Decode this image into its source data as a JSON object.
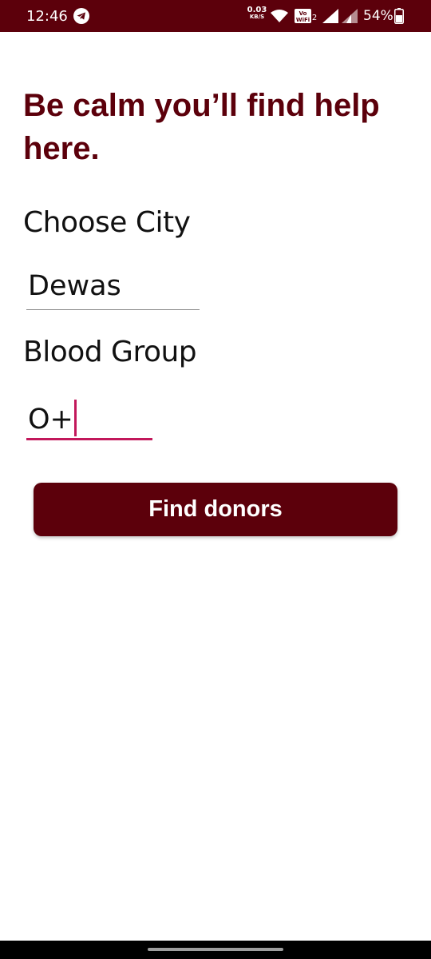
{
  "status_bar": {
    "time": "12:46",
    "net_speed_value": "0.03",
    "net_speed_unit": "KB/S",
    "vowifi_label": "Vo WiFi 2",
    "battery_percent": "54%",
    "background_color": "#5c000b",
    "icons": [
      "telegram-icon",
      "wifi-icon",
      "vowifi-badge",
      "signal-icon",
      "signal-icon",
      "battery-icon"
    ]
  },
  "main": {
    "headline": "Be calm you’ll find help here.",
    "city_label": "Choose City",
    "city_value": "Dewas",
    "blood_group_label": "Blood Group",
    "blood_group_value": "O+",
    "find_button_label": "Find donors",
    "accent_color": "#5c000b",
    "focus_color": "#c2185b"
  }
}
